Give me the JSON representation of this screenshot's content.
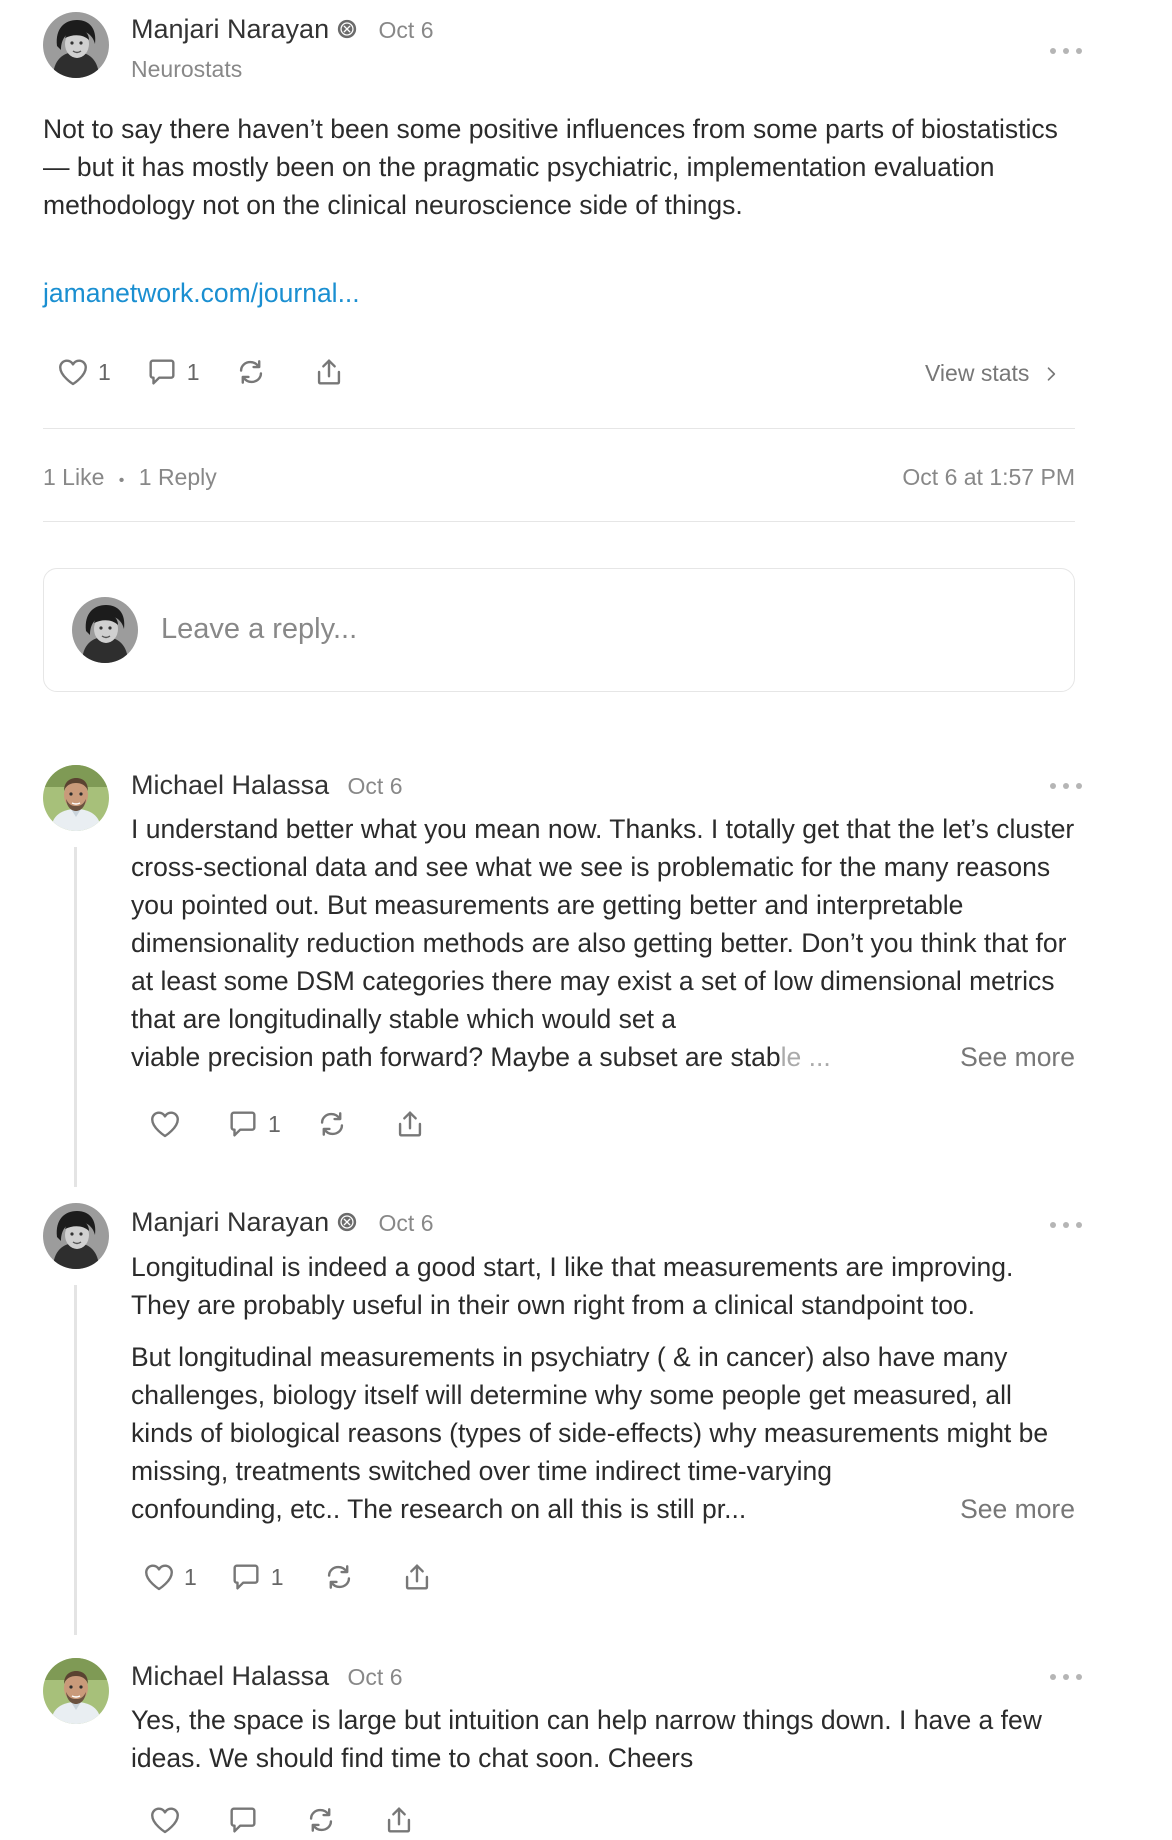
{
  "post": {
    "author": "Manjari Narayan",
    "date": "Oct 6",
    "subtitle": "Neurostats",
    "paragraphs": [
      "Not to say there haven’t been some positive influences from some parts of biostatistics — but it has mostly been on the pragmatic psychiatric, implementation evaluation methodology not on the clinical neuroscience side of things."
    ],
    "link": "jamanetwork.com/journal...",
    "like_count": "1",
    "comment_count": "1",
    "view_stats": "View stats",
    "likes_summary": "1 Like",
    "replies_summary": "1 Reply",
    "separator": "•",
    "timestamp": "Oct 6 at 1:57 PM"
  },
  "reply_box": {
    "placeholder": "Leave a reply..."
  },
  "comments": [
    {
      "author": "Michael Halassa",
      "date": "Oct 6",
      "text": "I understand better what you mean now. Thanks. I totally get that the let’s cluster cross-sectional data and see what we see is problematic for the many reasons you pointed out. But measurements are getting better and interpretable dimensionality reduction methods are also getting better. Don’t you think that for at least some DSM categories there may exist a set of low dimensional metrics that are longitudinally stable which would set a",
      "last_line": "viable precision path forward? Maybe a subset are stab",
      "last_line_fade": "le ...",
      "see_more": "See more",
      "like_count": "",
      "comment_count": "1"
    },
    {
      "author": "Manjari Narayan",
      "date": "Oct 6",
      "para1": "Longitudinal is indeed a good start, I like that measurements are improving. They are probably useful in their own right from a clinical standpoint too.",
      "para2": "But longitudinal measurements in psychiatry ( & in cancer) also have many challenges, biology itself will determine why some people get measured, all kinds of biological reasons (types of side-effects) why measurements might be missing, treatments switched over time indirect time-varying",
      "last_line": "confounding, etc..  The research on all this is still pr...",
      "see_more": "See more",
      "like_count": "1",
      "comment_count": "1"
    },
    {
      "author": "Michael Halassa",
      "date": "Oct 6",
      "text": "Yes, the space is large but intuition can help narrow things down. I have a few ideas. We should find time to chat soon. Cheers",
      "like_count": "",
      "comment_count": ""
    }
  ],
  "icons": {
    "like": "heart-icon",
    "comment": "comment-bubble-icon",
    "restack": "restack-icon",
    "share": "share-icon",
    "more": "ellipsis-icon",
    "chevron": "chevron-right-icon",
    "badge": "verified-badge-icon"
  },
  "colors": {
    "link": "#1a8fd1",
    "muted": "#888888",
    "text": "#2b2b2b",
    "divider": "#e6e6e6"
  }
}
